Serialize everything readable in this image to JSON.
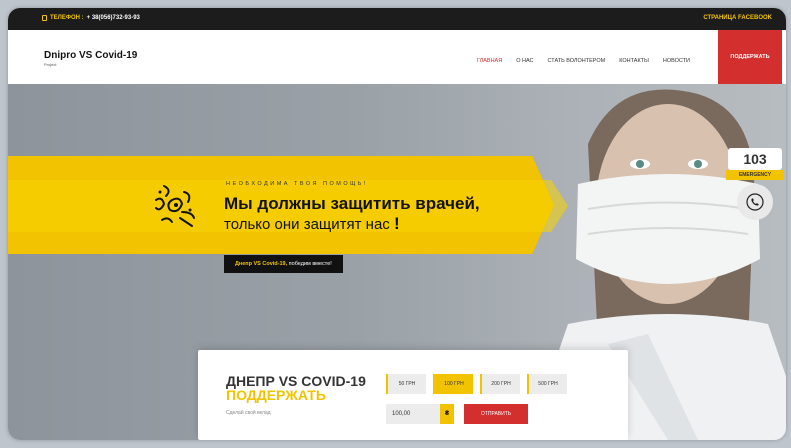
{
  "topbar": {
    "phone_label": "ТЕЛЕФОН :",
    "phone_number": "+ 38(056)732-93-93",
    "facebook_link": "СТРАНИЦА FACEBOOK"
  },
  "nav": {
    "brand_title": "Dnipro VS Covid-19",
    "brand_subtitle": "Project",
    "items": [
      {
        "label": "ГЛАВНАЯ",
        "active": true
      },
      {
        "label": "О НАС",
        "active": false
      },
      {
        "label": "СТАТЬ ВОЛОНТЕРОМ",
        "active": false
      },
      {
        "label": "КОНТАКТЫ",
        "active": false
      },
      {
        "label": "НОВОСТИ",
        "active": false
      }
    ],
    "support_button": "ПОДДЕРЖАТЬ"
  },
  "hero": {
    "kicker": "НЕОБХОДИМА ТВОЯ ПОМОЩЬ!",
    "headline": "Мы должны защитить врачей,",
    "subheadline": "только они защитят нас",
    "subheadline_mark": "!",
    "pill_brand": "Днепр VS Covid-19,",
    "pill_text": " победим вместе!"
  },
  "emergency": {
    "number": "103",
    "label": "EMERGENCY",
    "icon": "phone-icon"
  },
  "donate": {
    "title_main": "ДНЕПР VS COVID-19",
    "title_accent": "ПОДДЕРЖАТЬ",
    "subtitle": "Сделай свой вклад",
    "amounts": [
      {
        "label": "50 ГРН",
        "selected": false
      },
      {
        "label": "100 ГРН",
        "selected": true
      },
      {
        "label": "200 ГРН",
        "selected": false
      },
      {
        "label": "500 ГРН",
        "selected": false
      }
    ],
    "amount_value": "100,00",
    "currency_symbol": "₴",
    "pay_button": "ОТПРАВИТЬ"
  },
  "colors": {
    "accent": "#f2c300",
    "brand_red": "#d32f2f",
    "dark": "#1c1c1c"
  }
}
